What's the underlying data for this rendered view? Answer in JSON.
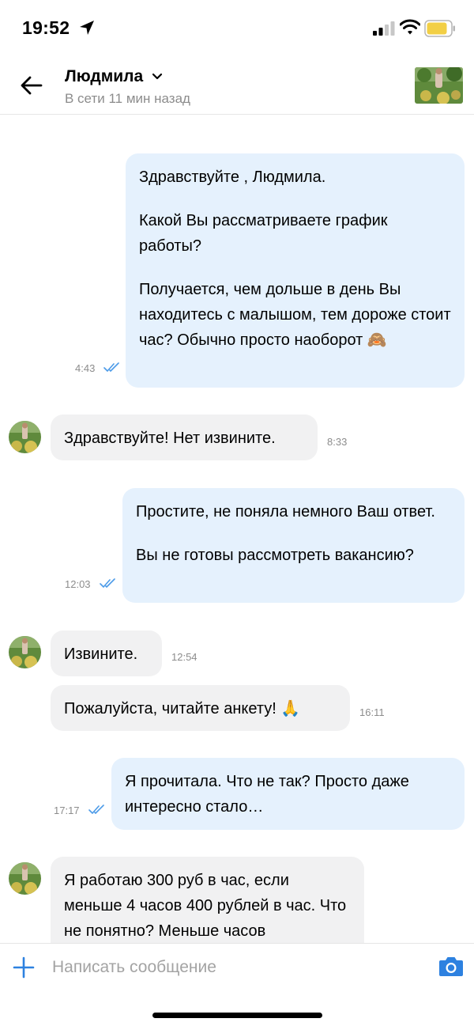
{
  "status_bar": {
    "time": "19:52",
    "icons": [
      "location-arrow-icon",
      "signal-icon",
      "wifi-icon",
      "battery-icon"
    ]
  },
  "header": {
    "contact_name": "Людмила",
    "status": "В сети 11 мин назад",
    "icons": [
      "back-arrow-icon",
      "chevron-down-icon"
    ]
  },
  "messages": [
    {
      "direction": "outgoing",
      "paragraphs": [
        "Здравствуйте , Людмила.",
        "Какой Вы рассматриваете график работы?",
        "Получается, чем дольше в день Вы находитесь с малышом, тем дороже стоит час? Обычно просто наоборот 🙈"
      ],
      "time": "4:43",
      "read": true
    },
    {
      "direction": "incoming",
      "paragraphs": [
        "Здравствуйте! Нет извините."
      ],
      "time": "8:33"
    },
    {
      "direction": "outgoing",
      "paragraphs": [
        "Простите, не поняла немного Ваш ответ.",
        "Вы не готовы рассмотреть вакансию?"
      ],
      "time": "12:03",
      "read": true
    },
    {
      "direction": "incoming",
      "paragraphs": [
        "Извините."
      ],
      "time": "12:54"
    },
    {
      "direction": "incoming",
      "paragraphs": [
        "Пожалуйста, читайте анкету! 🙏"
      ],
      "time": "16:11"
    },
    {
      "direction": "outgoing",
      "paragraphs": [
        "Я прочитала. Что не так? Просто даже интересно стало…"
      ],
      "time": "17:17",
      "read": true
    },
    {
      "direction": "incoming",
      "paragraphs": [
        "Я работаю 300 руб в час, если меньше 4 часов 400 рублей в час. Что не понятно? Меньше часов"
      ],
      "time": ""
    }
  ],
  "input": {
    "placeholder": "Написать сообщение",
    "value": "",
    "icons": [
      "plus-icon",
      "camera-icon"
    ]
  },
  "colors": {
    "accent": "#2d81e0",
    "outgoing_bubble": "#e5f1fd",
    "incoming_bubble": "#f1f1f2",
    "secondary_text": "#8c8c8c"
  }
}
